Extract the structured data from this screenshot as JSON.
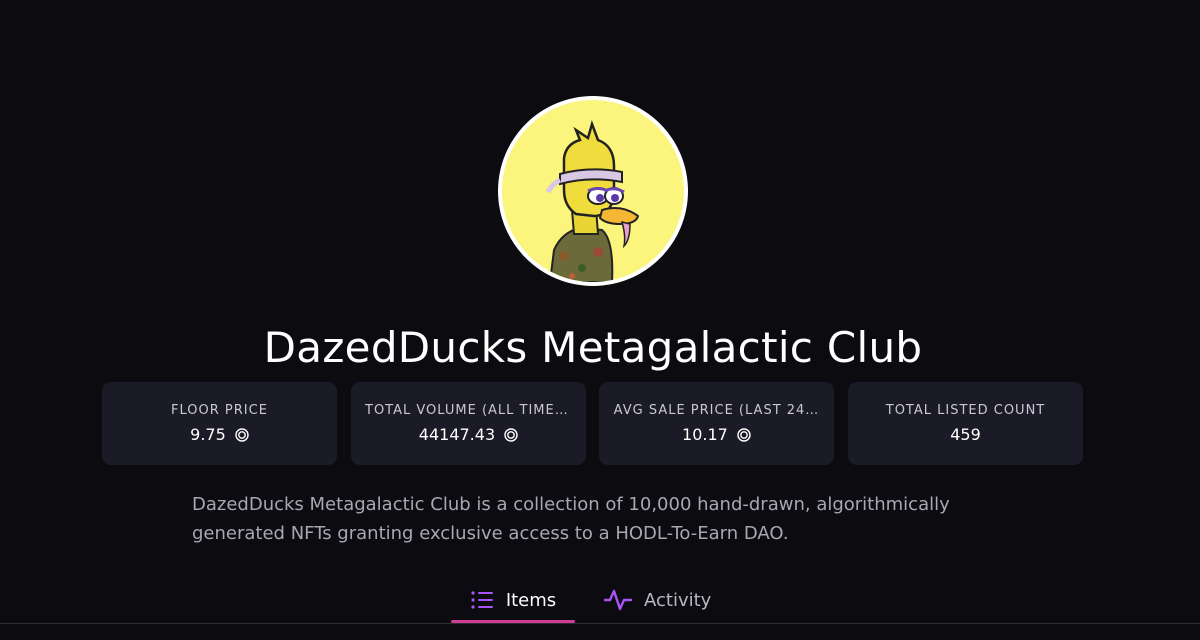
{
  "collection": {
    "title": "DazedDucks Metagalactic Club",
    "avatar_alt": "DazedDucks avatar",
    "description": "DazedDucks Metagalactic Club is a collection of 10,000 hand-drawn, algorithmically generated NFTs granting exclusive access to a HODL-To-Earn DAO."
  },
  "stats": [
    {
      "label": "FLOOR PRICE",
      "value": "9.75",
      "currency_icon": "sol-coin-icon"
    },
    {
      "label": "TOTAL VOLUME (ALL TIME,…",
      "value": "44147.43",
      "currency_icon": "sol-coin-icon"
    },
    {
      "label": "AVG SALE PRICE (LAST 24…",
      "value": "10.17",
      "currency_icon": "sol-coin-icon"
    },
    {
      "label": "TOTAL LISTED COUNT",
      "value": "459"
    }
  ],
  "tabs": [
    {
      "label": "Items",
      "icon": "list-icon",
      "active": true
    },
    {
      "label": "Activity",
      "icon": "activity-pulse-icon",
      "active": false
    }
  ],
  "colors": {
    "background": "#0b0b10",
    "card": "#1b1a27",
    "accent_purple": "#a855f7",
    "accent_pink": "#d03c92",
    "avatar_bg": "#fbf47d"
  }
}
